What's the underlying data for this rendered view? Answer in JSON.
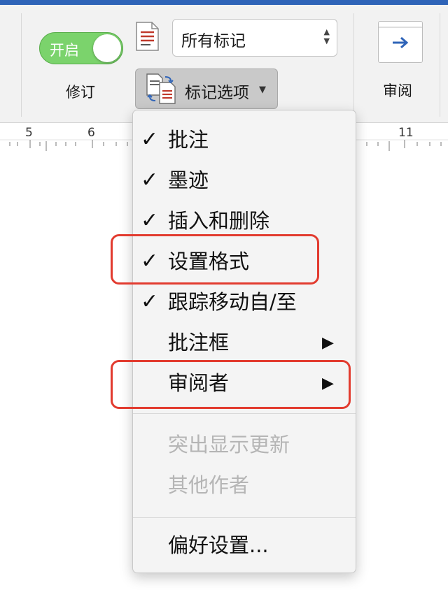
{
  "ribbon": {
    "toggle": {
      "label": "开启",
      "state": "on"
    },
    "track_changes_label": "修订",
    "markup_select": {
      "value": "所有标记"
    },
    "markup_options_button": {
      "label": "标记选项"
    },
    "review_label": "审阅"
  },
  "ruler": {
    "numbers": [
      "5",
      "6",
      "11"
    ]
  },
  "menu": {
    "items": [
      {
        "label": "批注",
        "checked": true,
        "disabled": false,
        "submenu": false
      },
      {
        "label": "墨迹",
        "checked": true,
        "disabled": false,
        "submenu": false
      },
      {
        "label": "插入和删除",
        "checked": true,
        "disabled": false,
        "submenu": false
      },
      {
        "label": "设置格式",
        "checked": true,
        "disabled": false,
        "submenu": false
      },
      {
        "label": "跟踪移动自/至",
        "checked": true,
        "disabled": false,
        "submenu": false
      },
      {
        "label": "批注框",
        "checked": false,
        "disabled": false,
        "submenu": true
      },
      {
        "label": "审阅者",
        "checked": false,
        "disabled": false,
        "submenu": true
      },
      {
        "label": "突出显示更新",
        "checked": false,
        "disabled": true,
        "submenu": false
      },
      {
        "label": "其他作者",
        "checked": false,
        "disabled": true,
        "submenu": false
      },
      {
        "label": "偏好设置...",
        "checked": false,
        "disabled": false,
        "submenu": false
      }
    ],
    "check_glyph": "✓",
    "submenu_glyph": "▶"
  },
  "colors": {
    "accent_blue": "#2f64b8",
    "toggle_on": "#7bd36c",
    "highlight_red": "#e23b2f",
    "disabled_text": "#b5b5b5"
  },
  "icons": [
    "document-markup-icon",
    "compare-documents-icon",
    "review-pane-icon",
    "select-arrows-icon",
    "dropdown-caret-icon",
    "checkmark-icon",
    "submenu-arrow-icon"
  ]
}
